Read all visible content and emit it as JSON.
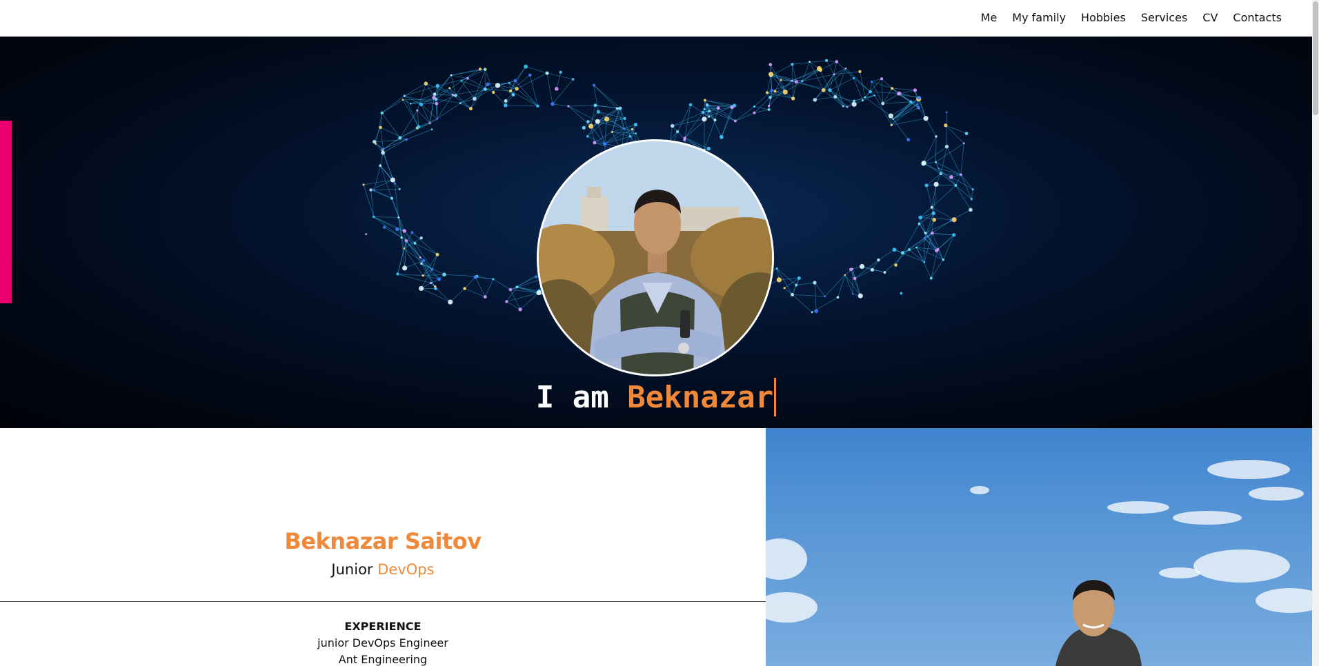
{
  "nav": {
    "items": [
      {
        "label": "Me"
      },
      {
        "label": "My family"
      },
      {
        "label": "Hobbies"
      },
      {
        "label": "Services"
      },
      {
        "label": "CV"
      },
      {
        "label": "Contacts"
      }
    ]
  },
  "hero": {
    "typed_prefix": "I am",
    "typed_name": "Beknazar",
    "side_tab_color": "#e8006f"
  },
  "about": {
    "name": "Beknazar Saitov",
    "role_prefix": "Junior",
    "role_accent": "DevOps",
    "experience_heading": "EXPERIENCE",
    "experience_title": "junior DevOps Engineer",
    "experience_company": "Ant Engineering"
  },
  "colors": {
    "accent": "#f0883a",
    "hero_background": "#010814",
    "network": "#3fc6ff"
  }
}
